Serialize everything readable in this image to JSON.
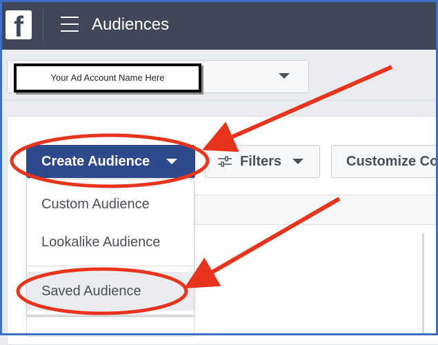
{
  "header": {
    "title": "Audiences",
    "logo_letter": "f"
  },
  "account": {
    "name": "Your Ad Account Name Here"
  },
  "toolbar": {
    "create_label": "Create Audience",
    "filters_label": "Filters",
    "customize_label": "Customize Columns"
  },
  "dropdown": {
    "items": [
      {
        "label": "Custom Audience"
      },
      {
        "label": "Lookalike Audience"
      },
      {
        "label": "Saved Audience"
      }
    ]
  },
  "colors": {
    "topbar": "#3f4758",
    "primary_button": "#2e4a8d",
    "annotation": "#e8341c",
    "frame": "#3d6fc4"
  },
  "icons": [
    "facebook-logo-icon",
    "menu-icon",
    "caret-down-icon",
    "filter-sliders-icon"
  ]
}
